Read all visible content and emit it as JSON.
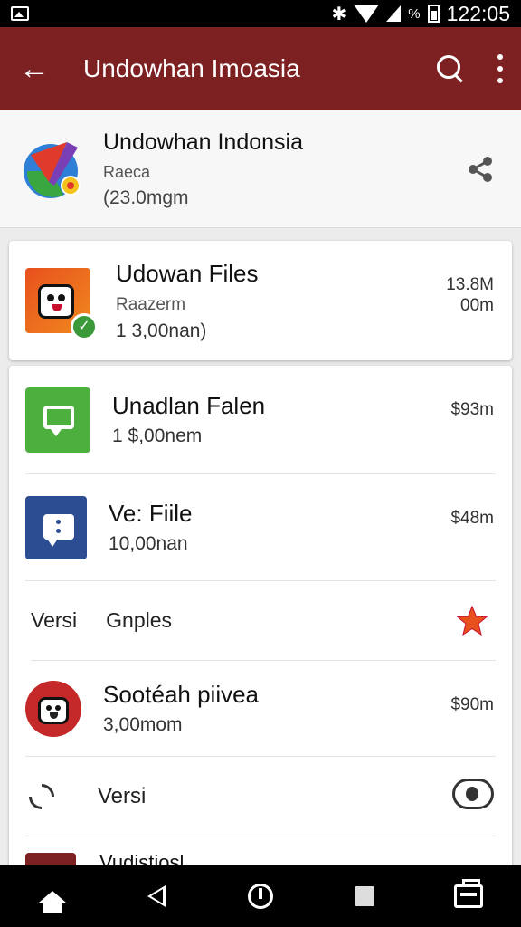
{
  "status_bar": {
    "battery_percent_label": "%",
    "time": "122:05"
  },
  "app_bar": {
    "title": "Undowhan Imoasia"
  },
  "header": {
    "name": "Undowhan Indonsia",
    "sub1": "Raeca",
    "sub2": "(23.0mgm"
  },
  "featured": {
    "title": "Udowan Files",
    "sub1": "Raazerm",
    "sub2": "1 3,00nan)",
    "size_line1": "13.8M",
    "size_line2": "00m"
  },
  "list": {
    "items": [
      {
        "title": "Unadlan Falen",
        "sub": "1 $,00nem",
        "size": "$93m"
      },
      {
        "title": "Ve: Fiile",
        "sub": "10,00nan",
        "size": "$48m"
      }
    ],
    "versi_row": {
      "label": "Versi",
      "value": "Gnples"
    },
    "red_item": {
      "title": "Sootéah piivea",
      "sub": "3,00mom",
      "size": "$90m"
    },
    "versi_toggle_row": {
      "label": "Versi"
    },
    "partial_item": {
      "title": "Vudistiosl"
    }
  },
  "colors": {
    "app_bar": "#7d2022",
    "star": "#e8501e",
    "green_icon": "#4caf3e",
    "blue_icon": "#2d4d92",
    "red_icon": "#c42828"
  },
  "icons": {
    "status": [
      "gallery-icon",
      "bluetooth-icon",
      "wifi-icon",
      "signal-icon",
      "battery-icon"
    ],
    "app_bar": [
      "back-arrow-icon",
      "search-icon",
      "overflow-menu-icon"
    ],
    "nav": [
      "home-icon",
      "back-icon",
      "power-icon",
      "recents-icon",
      "cart-icon"
    ]
  }
}
